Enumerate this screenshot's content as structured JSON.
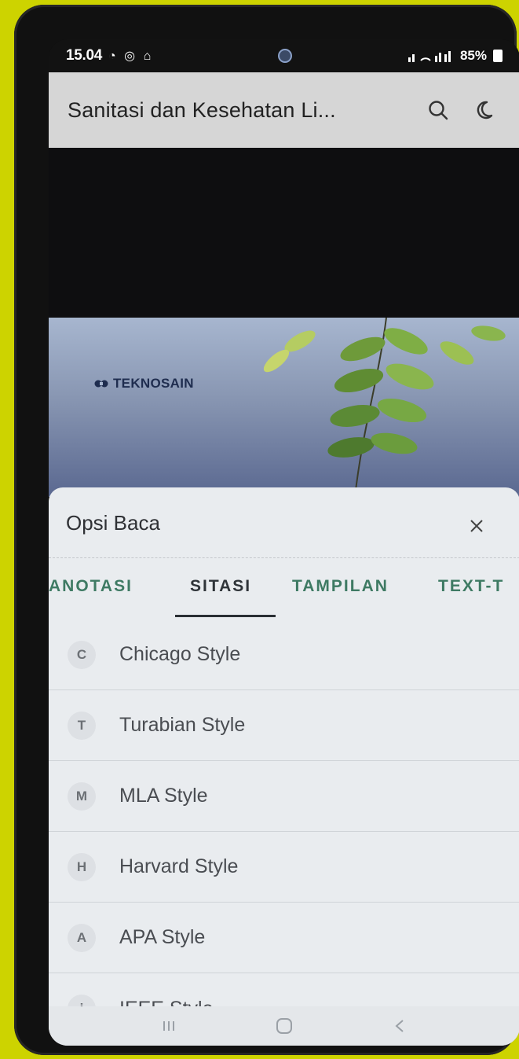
{
  "status_bar": {
    "time": "15.04",
    "left_icons": "◔ ◎ ⌂",
    "battery": "85%"
  },
  "app_bar": {
    "title": "Sanitasi dan Kesehatan Li..."
  },
  "cover": {
    "logo_text": "TEKNOSAIN"
  },
  "sheet": {
    "title": "Opsi Baca",
    "tabs": [
      {
        "label": "ANOTASI",
        "active": false
      },
      {
        "label": "SITASI",
        "active": true
      },
      {
        "label": "TAMPILAN",
        "active": false
      },
      {
        "label": "TEXT-T",
        "active": false
      }
    ],
    "items": [
      {
        "badge": "C",
        "label": "Chicago Style"
      },
      {
        "badge": "T",
        "label": "Turabian Style"
      },
      {
        "badge": "M",
        "label": "MLA Style"
      },
      {
        "badge": "H",
        "label": "Harvard Style"
      },
      {
        "badge": "A",
        "label": "APA Style"
      },
      {
        "badge": "i",
        "label": "IEEE Style"
      }
    ]
  },
  "colors": {
    "accent_tab": "#3e7a63",
    "sheet_bg": "#e9ecef",
    "app_bar_bg": "#d6d6d6"
  }
}
